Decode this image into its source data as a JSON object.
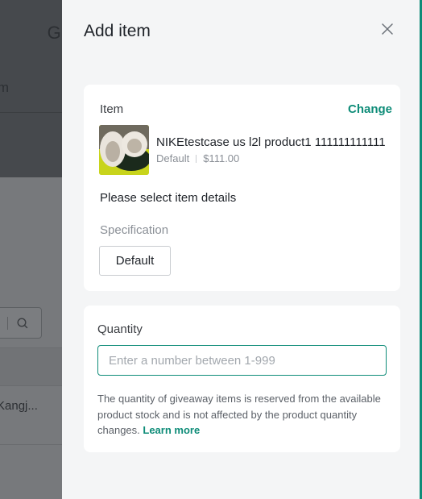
{
  "background": {
    "title": "Giveaway",
    "tab": "Item",
    "search_icon": "search-icon",
    "table_cell": "Kangj..."
  },
  "drawer": {
    "title": "Add item",
    "close_icon": "close-icon",
    "accent_color": "#0e8c78",
    "item_card": {
      "label": "Item",
      "change_label": "Change",
      "product": {
        "name": "NIKEtestcase us l2l product1 111111111111",
        "variant": "Default",
        "price": "$111.00"
      },
      "details_heading": "Please select item details",
      "specification_label": "Specification",
      "specification_option": "Default"
    },
    "quantity_card": {
      "label": "Quantity",
      "value": "",
      "placeholder": "Enter a number between 1-999",
      "help_text": "The quantity of giveaway items is reserved from the available product stock and is not affected by the product quantity changes.",
      "learn_more": "Learn more"
    }
  }
}
